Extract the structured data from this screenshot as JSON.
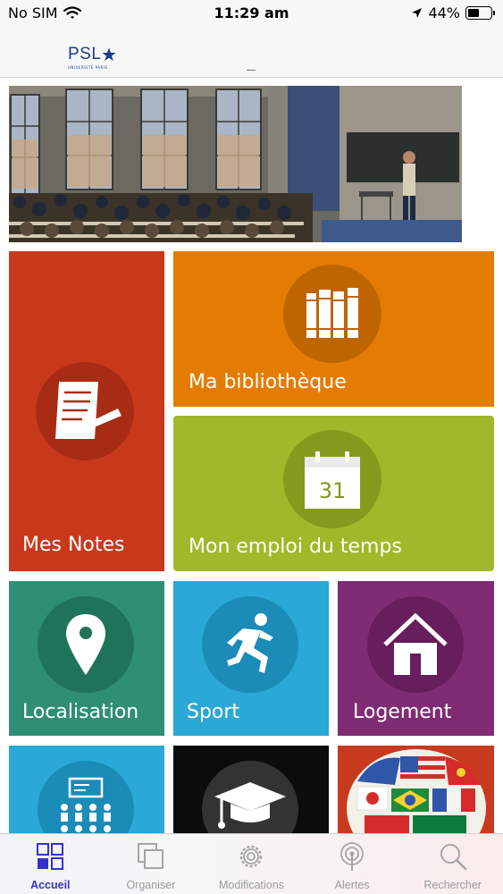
{
  "status_bar": {
    "carrier": "No SIM",
    "time": "11:29 am",
    "battery": "44%",
    "battery_level": 0.44
  },
  "header": {
    "logo_text": "PSL",
    "logo_subtitle": "UNIVERSITÉ PARIS"
  },
  "tiles": {
    "notes": {
      "label": "Mes Notes",
      "color": "#c8391c",
      "icon": "document-edit-icon"
    },
    "bibliotheque": {
      "label": "Ma bibliothèque",
      "color": "#e47c03",
      "icon": "books-icon"
    },
    "emploi": {
      "label": "Mon emploi du temps",
      "color": "#a0b82a",
      "icon": "calendar-icon",
      "calendar_day": "31"
    },
    "localisation": {
      "label": "Localisation",
      "color": "#2e8f73",
      "icon": "map-pin-icon"
    },
    "sport": {
      "label": "Sport",
      "color": "#2aa8d8",
      "icon": "running-person-icon"
    },
    "logement": {
      "label": "Logement",
      "color": "#802c74",
      "icon": "house-icon"
    },
    "partial_1": {
      "color": "#2aa8d8",
      "icon": "classroom-icon"
    },
    "partial_2": {
      "color": "#0c0c0c",
      "icon": "graduation-cap-icon"
    },
    "partial_3": {
      "color": "#c83a1e",
      "icon": "flags-globe-icon"
    }
  },
  "tab_bar": {
    "active_color": "#3333cc",
    "items": [
      {
        "label": "Accueil",
        "icon": "grid-icon",
        "active": true
      },
      {
        "label": "Organiser",
        "icon": "stacked-squares-icon",
        "active": false
      },
      {
        "label": "Modifications",
        "icon": "gear-icon",
        "active": false
      },
      {
        "label": "Alertes",
        "icon": "broadcast-icon",
        "active": false
      },
      {
        "label": "Rechercher",
        "icon": "search-icon",
        "active": false
      }
    ]
  }
}
